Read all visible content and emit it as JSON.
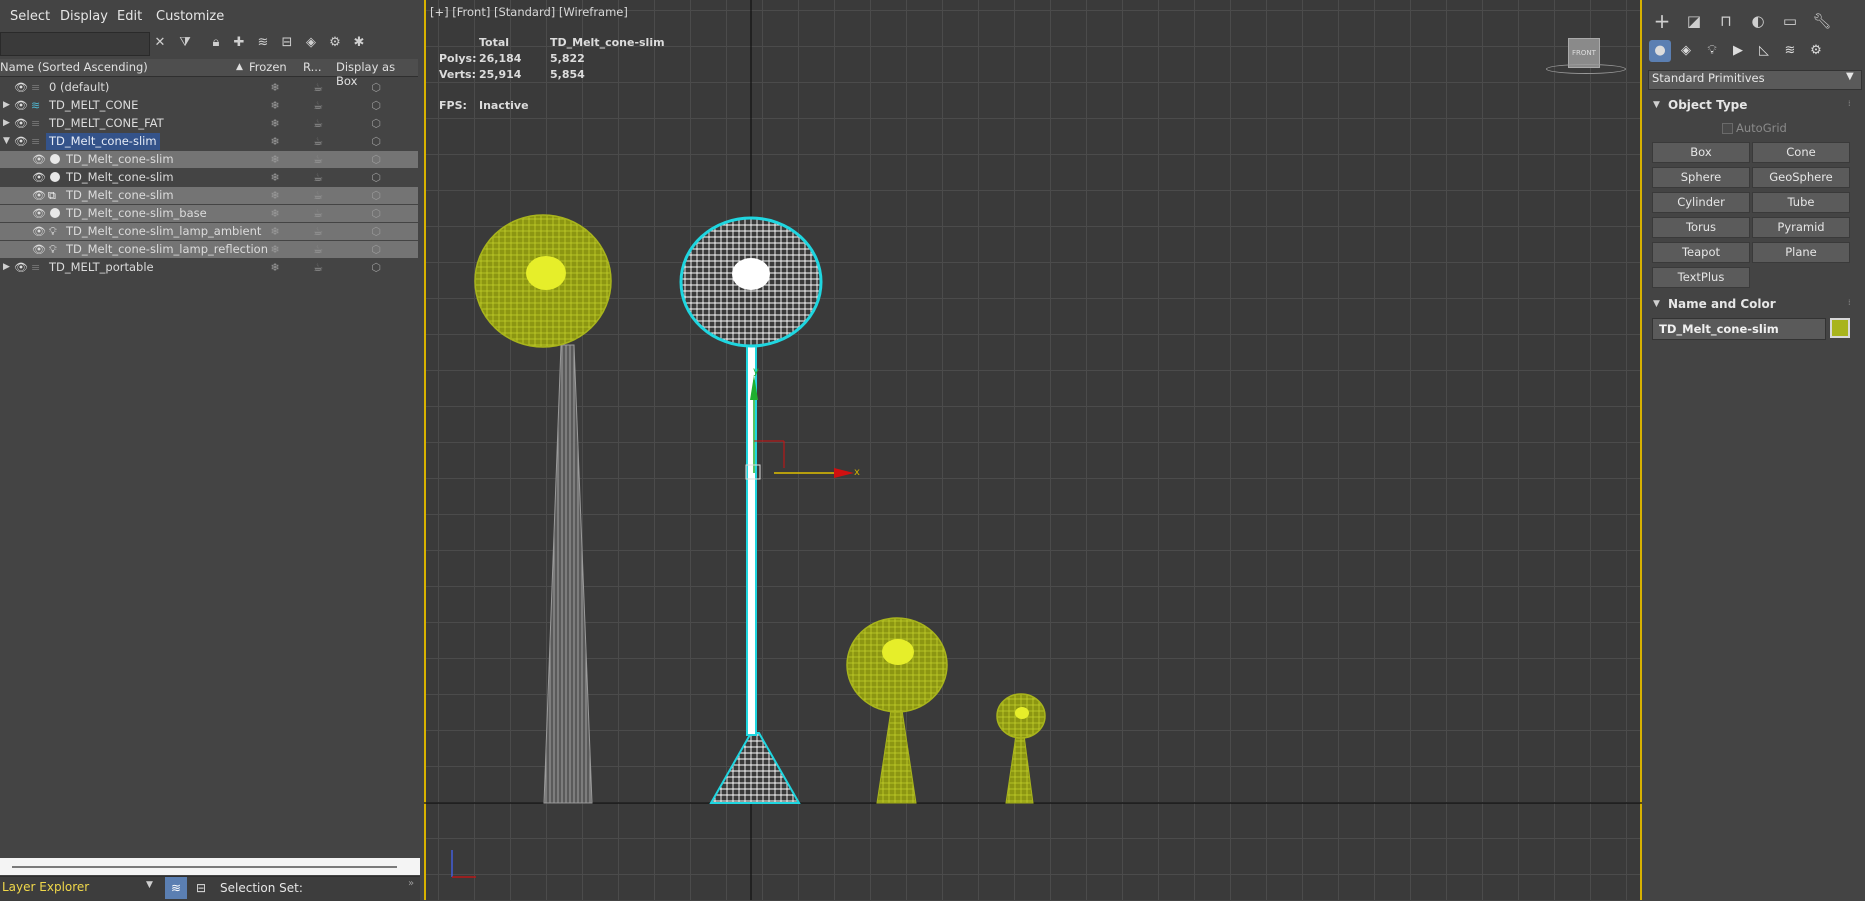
{
  "menu": [
    "Select",
    "Display",
    "Edit",
    "Customize"
  ],
  "explorer": {
    "columns": {
      "name": "Name (Sorted Ascending)",
      "frozen": "Frozen",
      "render": "R...",
      "box": "Display as Box"
    },
    "rows": [
      {
        "label": "0 (default)"
      },
      {
        "label": "TD_MELT_CONE"
      },
      {
        "label": "TD_MELT_CONE_FAT"
      },
      {
        "label": "TD_Melt_cone-slim"
      },
      {
        "label": "TD_Melt_cone-slim"
      },
      {
        "label": "TD_Melt_cone-slim"
      },
      {
        "label": "TD_Melt_cone-slim"
      },
      {
        "label": "TD_Melt_cone-slim_base"
      },
      {
        "label": "TD_Melt_cone-slim_lamp_ambient"
      },
      {
        "label": "TD_Melt_cone-slim_lamp_reflection"
      },
      {
        "label": "TD_MELT_portable"
      }
    ],
    "bottom": {
      "explorer_name": "Layer Explorer",
      "selection_set": "Selection Set:"
    }
  },
  "viewport": {
    "label": "[+] [Front] [Standard] [Wireframe]",
    "stats": {
      "total_label": "Total",
      "selected_label": "TD_Melt_cone-slim",
      "polys_label": "Polys:",
      "polys_total": "26,184",
      "polys_selected": "5,822",
      "verts_label": "Verts:",
      "verts_total": "25,914",
      "verts_selected": "5,854",
      "fps_label": "FPS:",
      "fps_value": "Inactive"
    },
    "viewcube_label": "FRONT",
    "axis_x": "x",
    "axis_y": "y",
    "colors": {
      "olive": "#a8b41c",
      "white": "#ffffff",
      "gray": "#9a9a9a",
      "cyan": "#1fd6e0"
    }
  },
  "command_panel": {
    "dropdown": "Standard Primitives",
    "object_type_title": "Object Type",
    "autogrid": "AutoGrid",
    "primitives": [
      "Box",
      "Cone",
      "Sphere",
      "GeoSphere",
      "Cylinder",
      "Tube",
      "Torus",
      "Pyramid",
      "Teapot",
      "Plane",
      "TextPlus"
    ],
    "name_color_title": "Name and Color",
    "object_name": "TD_Melt_cone-slim",
    "object_color": "#a8b41c"
  }
}
